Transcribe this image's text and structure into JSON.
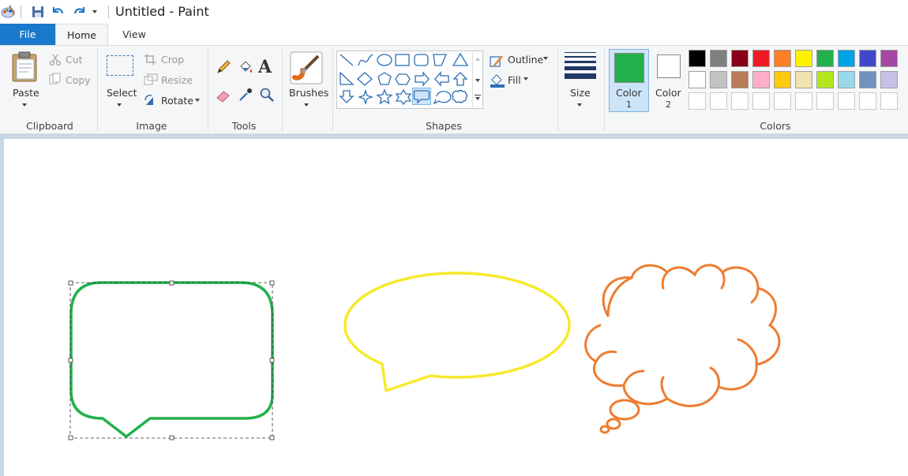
{
  "window": {
    "title": "Untitled - Paint"
  },
  "tabs": {
    "file": "File",
    "home": "Home",
    "view": "View"
  },
  "clipboard": {
    "paste": "Paste",
    "cut": "Cut",
    "copy": "Copy",
    "group": "Clipboard"
  },
  "image": {
    "select": "Select",
    "crop": "Crop",
    "resize": "Resize",
    "rotate": "Rotate",
    "group": "Image"
  },
  "tools": {
    "group": "Tools"
  },
  "brushes": {
    "label": "Brushes"
  },
  "shapes": {
    "outline": "Outline",
    "fill": "Fill",
    "group": "Shapes"
  },
  "size": {
    "label": "Size"
  },
  "colors": {
    "color1_label": "Color",
    "color1_num": "1",
    "color2_label": "Color",
    "color2_num": "2",
    "group": "Colors",
    "color1": "#22b14c",
    "color2": "#ffffff",
    "row1": [
      "#000000",
      "#7f7f7f",
      "#880015",
      "#ed1c24",
      "#ff7f27",
      "#fff200",
      "#22b14c",
      "#00a2e8",
      "#3f48cc",
      "#a349a4"
    ],
    "row2": [
      "#ffffff",
      "#c3c3c3",
      "#b97a57",
      "#ffaec9",
      "#ffc90e",
      "#efe4b0",
      "#b5e61d",
      "#99d9ea",
      "#7092be",
      "#c8bfe7"
    ]
  },
  "drawing": {
    "rect_callout_color": "#22b14c",
    "oval_callout_color": "#f7e92c",
    "cloud_callout_color": "#ed7d31"
  }
}
